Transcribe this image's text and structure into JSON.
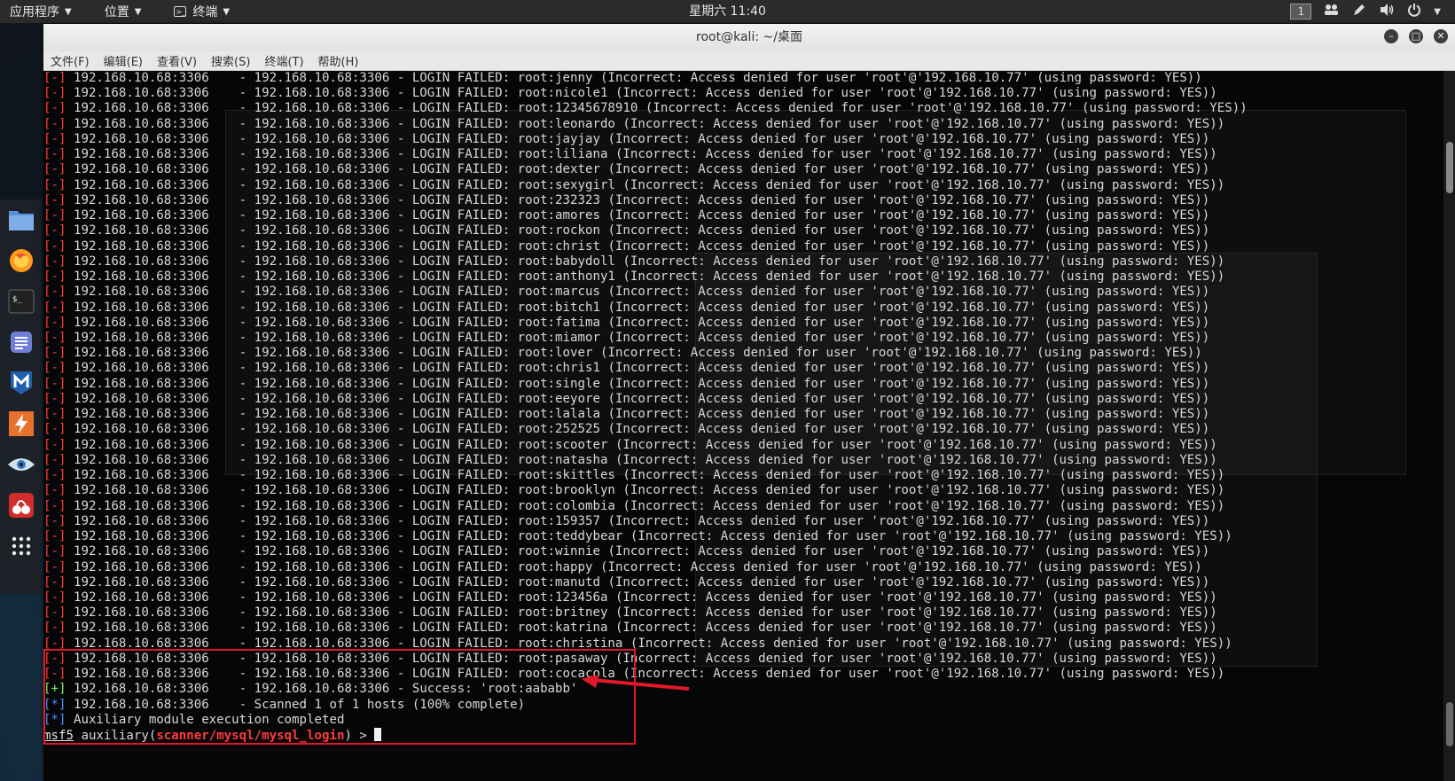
{
  "top_panel": {
    "applications": "应用程序",
    "places": "位置",
    "terminal": "终端",
    "clock": "星期六 11:40",
    "workspace": "1"
  },
  "window": {
    "title": "root@kali: ~/桌面",
    "menu": [
      "文件(F)",
      "编辑(E)",
      "查看(V)",
      "搜索(S)",
      "终端(T)",
      "帮助(H)"
    ]
  },
  "terminal": {
    "target": "192.168.10.68:3306",
    "fail_tag": "[-]",
    "ok_tag": "[+]",
    "info_tag": "[*]",
    "failed_lines": [
      {
        "user": "root:jenny",
        "tail": "(Incorrect: Access denied for user 'root'@'192.168.10.77' (using password: YES))"
      },
      {
        "user": "root:nicole1",
        "tail": "(Incorrect: Access denied for user 'root'@'192.168.10.77' (using password: YES))"
      },
      {
        "user": "root:12345678910",
        "tail": "(Incorrect: Access denied for user 'root'@'192.168.10.77' (using password: YES))"
      },
      {
        "user": "root:leonardo",
        "tail": "(Incorrect: Access denied for user 'root'@'192.168.10.77' (using password: YES))"
      },
      {
        "user": "root:jayjay",
        "tail": "(Incorrect: Access denied for user 'root'@'192.168.10.77' (using password: YES))"
      },
      {
        "user": "root:liliana",
        "tail": "(Incorrect: Access denied for user 'root'@'192.168.10.77' (using password: YES))"
      },
      {
        "user": "root:dexter",
        "tail": "(Incorrect: Access denied for user 'root'@'192.168.10.77' (using password: YES))"
      },
      {
        "user": "root:sexygirl",
        "tail": "(Incorrect: Access denied for user 'root'@'192.168.10.77' (using password: YES))"
      },
      {
        "user": "root:232323",
        "tail": "(Incorrect: Access denied for user 'root'@'192.168.10.77' (using password: YES))"
      },
      {
        "user": "root:amores",
        "tail": "(Incorrect: Access denied for user 'root'@'192.168.10.77' (using password: YES))"
      },
      {
        "user": "root:rockon",
        "tail": "(Incorrect: Access denied for user 'root'@'192.168.10.77' (using password: YES))"
      },
      {
        "user": "root:christ",
        "tail": "(Incorrect: Access denied for user 'root'@'192.168.10.77' (using password: YES))"
      },
      {
        "user": "root:babydoll",
        "tail": "(Incorrect: Access denied for user 'root'@'192.168.10.77' (using password: YES))"
      },
      {
        "user": "root:anthony1",
        "tail": "(Incorrect: Access denied for user 'root'@'192.168.10.77' (using password: YES))"
      },
      {
        "user": "root:marcus",
        "tail": "(Incorrect: Access denied for user 'root'@'192.168.10.77' (using password: YES))"
      },
      {
        "user": "root:bitch1",
        "tail": "(Incorrect: Access denied for user 'root'@'192.168.10.77' (using password: YES))"
      },
      {
        "user": "root:fatima",
        "tail": "(Incorrect: Access denied for user 'root'@'192.168.10.77' (using password: YES))"
      },
      {
        "user": "root:miamor",
        "tail": "(Incorrect: Access denied for user 'root'@'192.168.10.77' (using password: YES))"
      },
      {
        "user": "root:lover",
        "tail": "(Incorrect: Access denied for user 'root'@'192.168.10.77' (using password: YES))"
      },
      {
        "user": "root:chris1",
        "tail": "(Incorrect: Access denied for user 'root'@'192.168.10.77' (using password: YES))"
      },
      {
        "user": "root:single",
        "tail": "(Incorrect: Access denied for user 'root'@'192.168.10.77' (using password: YES))"
      },
      {
        "user": "root:eeyore",
        "tail": "(Incorrect: Access denied for user 'root'@'192.168.10.77' (using password: YES))"
      },
      {
        "user": "root:lalala",
        "tail": "(Incorrect: Access denied for user 'root'@'192.168.10.77' (using password: YES))"
      },
      {
        "user": "root:252525",
        "tail": "(Incorrect: Access denied for user 'root'@'192.168.10.77' (using password: YES))"
      },
      {
        "user": "root:scooter",
        "tail": "(Incorrect: Access denied for user 'root'@'192.168.10.77' (using password: YES))"
      },
      {
        "user": "root:natasha",
        "tail": "(Incorrect: Access denied for user 'root'@'192.168.10.77' (using password: YES))"
      },
      {
        "user": "root:skittles",
        "tail": "(Incorrect: Access denied for user 'root'@'192.168.10.77' (using password: YES))"
      },
      {
        "user": "root:brooklyn",
        "tail": "(Incorrect: Access denied for user 'root'@'192.168.10.77' (using password: YES))"
      },
      {
        "user": "root:colombia",
        "tail": "(Incorrect: Access denied for user 'root'@'192.168.10.77' (using password: YES))"
      },
      {
        "user": "root:159357",
        "tail": "(Incorrect: Access denied for user 'root'@'192.168.10.77' (using password: YES))"
      },
      {
        "user": "root:teddybear",
        "tail": "(Incorrect: Access denied for user 'root'@'192.168.10.77' (using password: YES))"
      },
      {
        "user": "root:winnie",
        "tail": "(Incorrect: Access denied for user 'root'@'192.168.10.77' (using password: YES))"
      },
      {
        "user": "root:happy",
        "tail": "(Incorrect: Access denied for user 'root'@'192.168.10.77' (using password: YES))"
      },
      {
        "user": "root:manutd",
        "tail": "(Incorrect: Access denied for user 'root'@'192.168.10.77' (using password: YES))"
      },
      {
        "user": "root:123456a",
        "tail": "(Incorrect: Access denied for user 'root'@'192.168.10.77' (using password: YES))"
      },
      {
        "user": "root:britney",
        "tail": "(Incorrect: Access denied for user 'root'@'192.168.10.77' (using password: YES))"
      },
      {
        "user": "root:katrina",
        "tail": "(Incorrect: Access denied for user 'root'@'192.168.10.77' (using password: YES))"
      },
      {
        "user": "root:christina",
        "tail": "(Incorrect: Access denied for user 'root'@'192.168.10.77' (using password: YES))"
      },
      {
        "user": "root:pasaway",
        "tail": "(Incorrect: Access denied for user 'root'@'192.168.10.77' (using password: YES))"
      },
      {
        "user": "root:cocacola",
        "tail": "(Incorrect: Access denied for user 'root'@'192.168.10.77' (using password: YES))"
      }
    ],
    "success_text": "Success: 'root:aababb'",
    "scanned_text": "Scanned 1 of 1 hosts (100% complete)",
    "completed_text": "Auxiliary module execution completed",
    "prompt_prefix": "msf5",
    "prompt_mid": "auxiliary(",
    "prompt_module": "scanner/mysql/mysql_login",
    "prompt_end": ") > "
  },
  "colors": {
    "fail": "#ff3b3b",
    "success": "#7cf06a",
    "info": "#4f8bff",
    "highlight_box": "#e0182a"
  },
  "dock_icons": [
    "files-icon",
    "firefox-icon",
    "terminal-icon",
    "text-editor-icon",
    "metasploit-icon",
    "burpsuite-icon",
    "eye-icon",
    "cherrytree-icon",
    "app-grid-icon"
  ]
}
